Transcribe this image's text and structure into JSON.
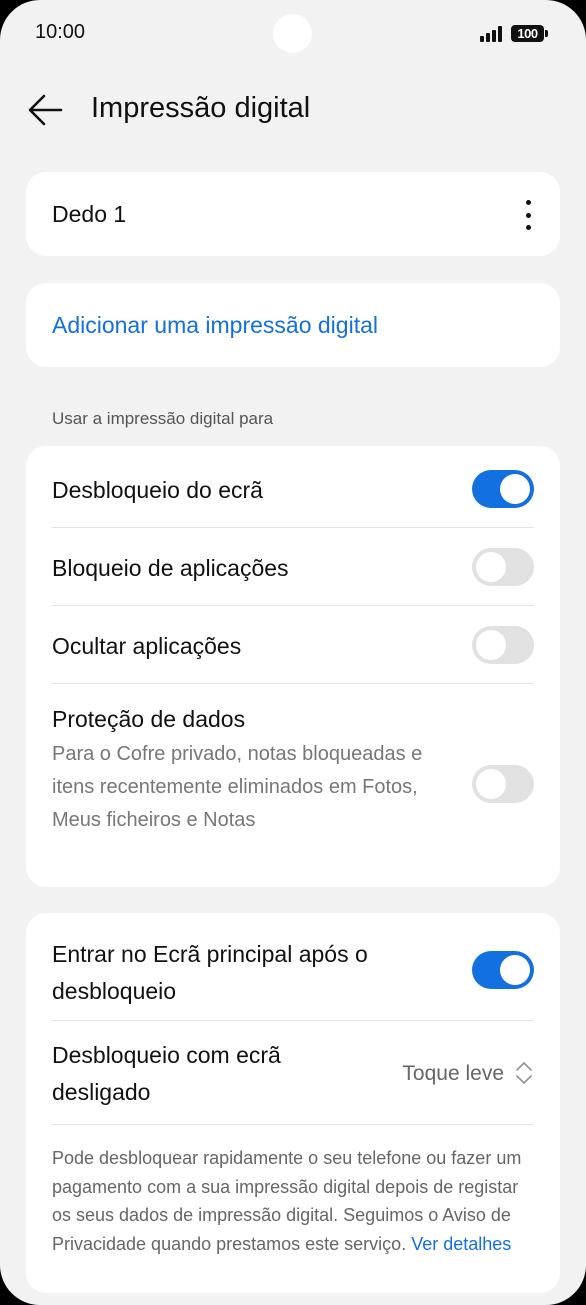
{
  "status_bar": {
    "time": "10:00",
    "battery": "100"
  },
  "header": {
    "title": "Impressão digital"
  },
  "finger": {
    "label": "Dedo 1"
  },
  "add": {
    "label": "Adicionar uma impressão digital"
  },
  "section": {
    "label": "Usar a impressão digital para"
  },
  "options": [
    {
      "label": "Desbloqueio do ecrã",
      "enabled": true
    },
    {
      "label": "Bloqueio de aplicações",
      "enabled": false
    },
    {
      "label": "Ocultar aplicações",
      "enabled": false
    },
    {
      "label": "Proteção de dados",
      "description": "Para o Cofre privado, notas bloqueadas e itens recentemente eliminados em Fotos, Meus ficheiros e Notas",
      "enabled": false
    }
  ],
  "home": {
    "label": "Entrar no Ecrã principal após o desbloqueio",
    "enabled": true
  },
  "screen_off": {
    "label": "Desbloqueio com ecrã desligado",
    "value": "Toque leve"
  },
  "footer": {
    "text": "Pode desbloquear rapidamente o seu telefone ou fazer um pagamento com a sua impressão digital depois de registar os seus dados de impressão digital. Seguimos o Aviso de Privacidade quando prestamos este serviço.",
    "link": "Ver detalhes"
  },
  "colors": {
    "accent": "#1370e0",
    "toggle_off": "#e1e1e1",
    "background": "#f2f2f2"
  }
}
